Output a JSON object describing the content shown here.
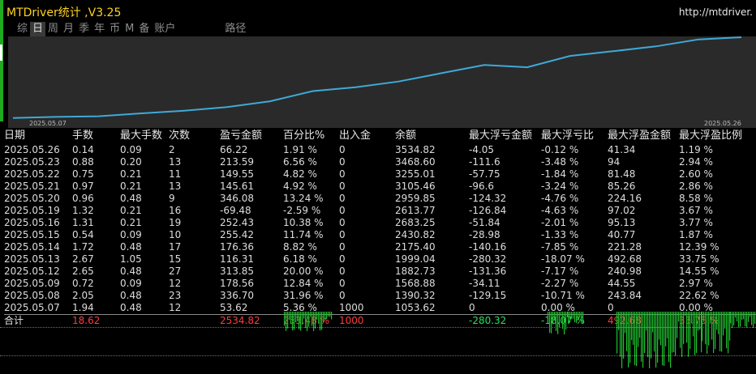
{
  "window": {
    "title": "MTDriver统计 ,V3.25",
    "url": "http://mtdriver."
  },
  "tabs": [
    {
      "label": "综",
      "active": false
    },
    {
      "label": "日",
      "active": true
    },
    {
      "label": "周",
      "active": false
    },
    {
      "label": "月",
      "active": false
    },
    {
      "label": "季",
      "active": false
    },
    {
      "label": "年",
      "active": false
    },
    {
      "label": "币",
      "active": false
    },
    {
      "label": "M",
      "active": false
    },
    {
      "label": "备",
      "active": false
    },
    {
      "label": "账户",
      "active": false
    },
    {
      "label": "路径",
      "active": false
    }
  ],
  "chart_data": {
    "type": "line",
    "x_start_label": "2025.05.07",
    "x_end_label": "2025.05.26",
    "series": [
      {
        "values": [
          1053.62,
          1090,
          1110,
          1200,
          1280,
          1390.32,
          1568.88,
          1882.73,
          1999.04,
          2175.4,
          2430.82,
          2683.25,
          2613.77,
          2959.85,
          3105.46,
          3255.01,
          3468.6,
          3534.82
        ]
      }
    ],
    "line_color": "#3fa9d8"
  },
  "table": {
    "headers": [
      "日期",
      "手数",
      "最大手数",
      "次数",
      "盈亏金额",
      "百分比%",
      "出入金",
      "余额",
      "最大浮亏金额",
      "最大浮亏比",
      "最大浮盈金额",
      "最大浮盈比例"
    ],
    "rows": [
      [
        "2025.05.26",
        "0.14",
        "0.09",
        "2",
        "66.22",
        "1.91 %",
        "0",
        "3534.82",
        "-4.05",
        "-0.12 %",
        "41.34",
        "1.19 %"
      ],
      [
        "2025.05.23",
        "0.88",
        "0.20",
        "13",
        "213.59",
        "6.56 %",
        "0",
        "3468.60",
        "-111.6",
        "-3.48 %",
        "94",
        "2.94 %"
      ],
      [
        "2025.05.22",
        "0.75",
        "0.21",
        "11",
        "149.55",
        "4.82 %",
        "0",
        "3255.01",
        "-57.75",
        "-1.84 %",
        "81.48",
        "2.60 %"
      ],
      [
        "2025.05.21",
        "0.97",
        "0.21",
        "13",
        "145.61",
        "4.92 %",
        "0",
        "3105.46",
        "-96.6",
        "-3.24 %",
        "85.26",
        "2.86 %"
      ],
      [
        "2025.05.20",
        "0.96",
        "0.48",
        "9",
        "346.08",
        "13.24 %",
        "0",
        "2959.85",
        "-124.32",
        "-4.76 %",
        "224.16",
        "8.58 %"
      ],
      [
        "2025.05.19",
        "1.32",
        "0.21",
        "16",
        "-69.48",
        "-2.59 %",
        "0",
        "2613.77",
        "-126.84",
        "-4.63 %",
        "97.02",
        "3.67 %"
      ],
      [
        "2025.05.16",
        "1.31",
        "0.21",
        "19",
        "252.43",
        "10.38 %",
        "0",
        "2683.25",
        "-51.84",
        "-2.01 %",
        "95.13",
        "3.77 %"
      ],
      [
        "2025.05.15",
        "0.54",
        "0.09",
        "10",
        "255.42",
        "11.74 %",
        "0",
        "2430.82",
        "-28.98",
        "-1.33 %",
        "40.77",
        "1.87 %"
      ],
      [
        "2025.05.14",
        "1.72",
        "0.48",
        "17",
        "176.36",
        "8.82 %",
        "0",
        "2175.40",
        "-140.16",
        "-7.85 %",
        "221.28",
        "12.39 %"
      ],
      [
        "2025.05.13",
        "2.67",
        "1.05",
        "15",
        "116.31",
        "6.18 %",
        "0",
        "1999.04",
        "-280.32",
        "-18.07 %",
        "492.68",
        "33.75 %"
      ],
      [
        "2025.05.12",
        "2.65",
        "0.48",
        "27",
        "313.85",
        "20.00 %",
        "0",
        "1882.73",
        "-131.36",
        "-7.17 %",
        "240.98",
        "14.55 %"
      ],
      [
        "2025.05.09",
        "0.72",
        "0.09",
        "12",
        "178.56",
        "12.84 %",
        "0",
        "1568.88",
        "-34.11",
        "-2.27 %",
        "44.55",
        "2.97 %"
      ],
      [
        "2025.05.08",
        "2.05",
        "0.48",
        "23",
        "336.70",
        "31.96 %",
        "0",
        "1390.32",
        "-129.15",
        "-10.71 %",
        "243.84",
        "22.62 %"
      ],
      [
        "2025.05.07",
        "1.94",
        "0.48",
        "12",
        "53.62",
        "5.36 %",
        "1000",
        "1053.62",
        "0",
        "0.00 %",
        "0",
        "0.00 %"
      ]
    ],
    "summary": [
      "合计",
      "18.62",
      "",
      "",
      "2534.82",
      "253.48 %",
      "1000",
      "",
      "-280.32",
      "-18.07 %",
      "492.68",
      "33.75 %"
    ]
  },
  "colors": {
    "title": "#ffd21f",
    "profit": "#ff3b3b",
    "loss": "#23e15a",
    "line": "#3fa9d8",
    "chart_bg": "#2a2a2a"
  }
}
